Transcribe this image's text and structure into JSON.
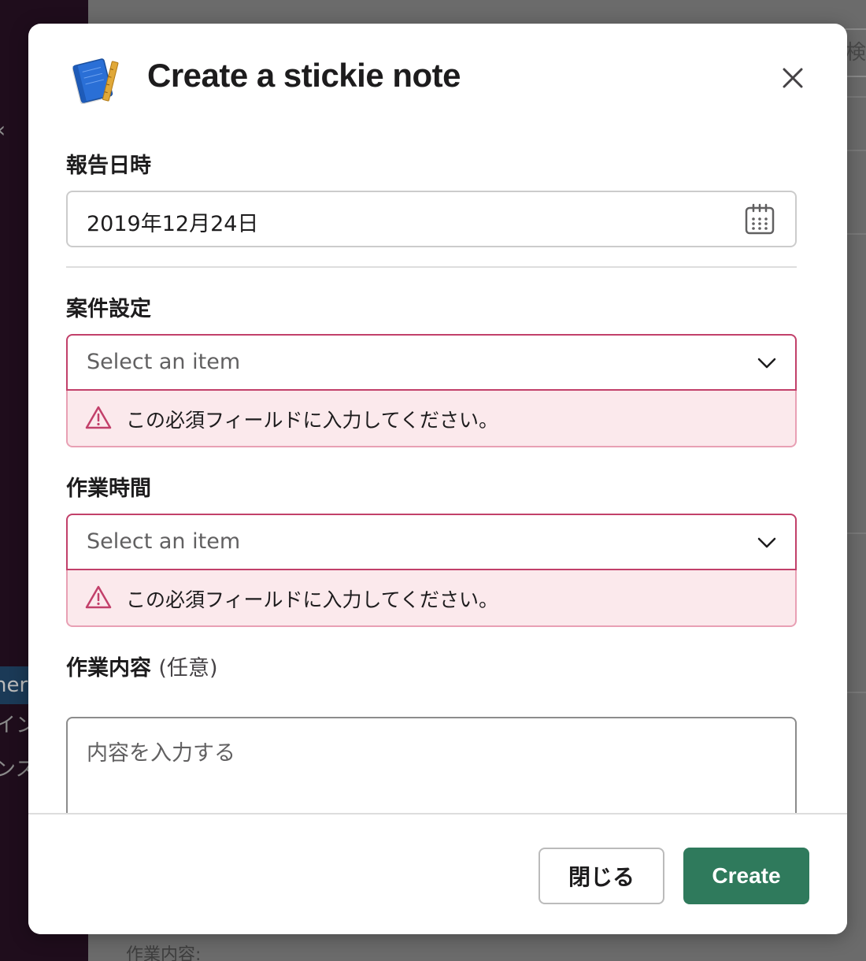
{
  "background": {
    "sidebar_highlight_text": "ner",
    "sidebar_item_1": "イン",
    "sidebar_item_2": "ンス",
    "search_fragment": "検",
    "bottom_text": "作業内容:"
  },
  "modal": {
    "title": "Create a stickie note",
    "app_icon": "blueprint-notebook-icon",
    "close_icon": "close-icon"
  },
  "fields": {
    "report_date": {
      "label": "報告日時",
      "value": "2019年12月24日",
      "icon": "calendar-icon"
    },
    "project": {
      "label": "案件設定",
      "placeholder": "Select an item",
      "error": "この必須フィールドに入力してください。"
    },
    "work_hours": {
      "label": "作業時間",
      "placeholder": "Select an item",
      "error": "この必須フィールドに入力してください。"
    },
    "work_details": {
      "label": "作業内容",
      "optional": "(任意)",
      "placeholder": "内容を入力する"
    }
  },
  "footer": {
    "close_label": "閉じる",
    "create_label": "Create"
  },
  "colors": {
    "primary": "#2f7a5c",
    "error_border": "#c2406a",
    "error_bg": "#fbe9ec"
  }
}
